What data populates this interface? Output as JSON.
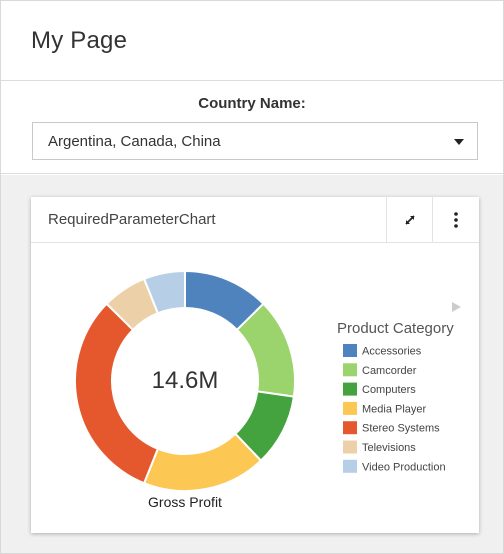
{
  "page": {
    "title": "My Page"
  },
  "filter": {
    "label": "Country Name:",
    "selected_value": "Argentina, Canada, China"
  },
  "widget": {
    "title": "RequiredParameterChart",
    "expand_icon": "expand-arrows-icon",
    "menu_icon": "vertical-dots-menu-icon"
  },
  "chart_data": {
    "type": "pie",
    "style": "donut",
    "center_value": "14.6M",
    "label": "Gross Profit",
    "legend_title": "Product Category",
    "legend_placement": "right",
    "legend_scroll_icon": "play-triangle-icon",
    "categories": [
      "Accessories",
      "Camcorder",
      "Computers",
      "Media Player",
      "Stereo Systems",
      "Televisions",
      "Video Production"
    ],
    "values": [
      12.5,
      14.5,
      10.5,
      18.0,
      31.0,
      6.5,
      6.0
    ],
    "colors": [
      "#4f83bd",
      "#9bd36d",
      "#45a33f",
      "#fcc853",
      "#e5582d",
      "#ecd0a7",
      "#b7cfe6"
    ]
  }
}
